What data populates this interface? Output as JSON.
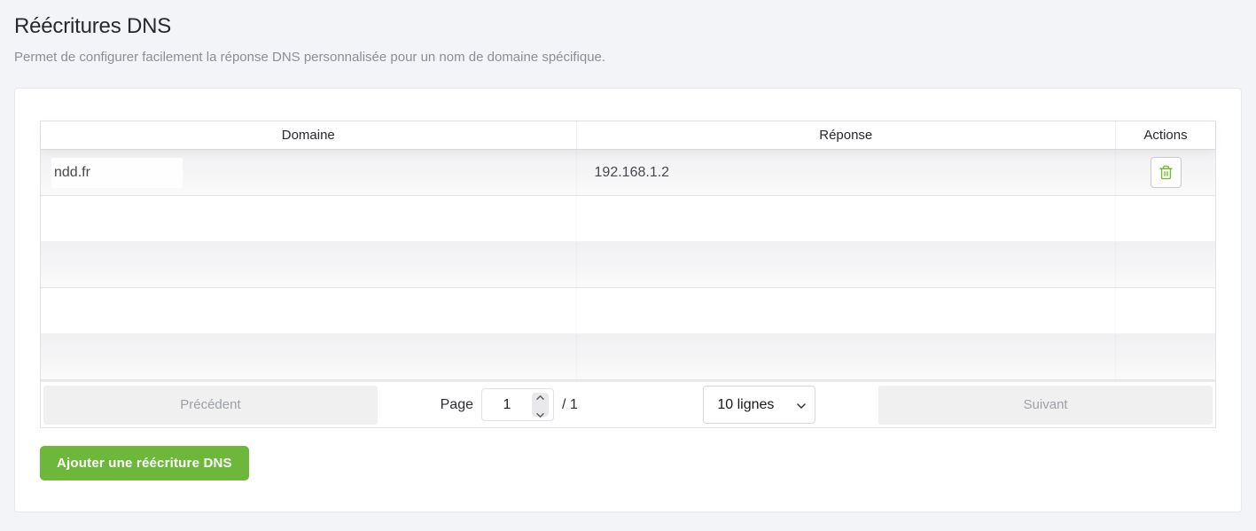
{
  "page": {
    "title": "Réécritures DNS",
    "subtitle": "Permet de configurer facilement la réponse DNS personnalisée pour un nom de domaine spécifique."
  },
  "table": {
    "columns": {
      "domain": "Domaine",
      "response": "Réponse",
      "actions": "Actions"
    },
    "rows": [
      {
        "domain": "ndd.fr",
        "response": "192.168.1.2"
      }
    ]
  },
  "pagination": {
    "previous_label": "Précédent",
    "page_label": "Page",
    "current_page": "1",
    "total_label": "/ 1",
    "page_size_value": "10 lignes",
    "next_label": "Suivant"
  },
  "toolbar": {
    "add_button_label": "Ajouter une réécriture DNS"
  },
  "icons": {
    "delete_row": "trash-icon",
    "page_size": "chevron-down-icon",
    "spinner": "chevron-up-down-icons"
  },
  "colors": {
    "accent_green": "#6db83a",
    "icon_green": "#79b82e",
    "page_background": "#f3f4f7"
  }
}
